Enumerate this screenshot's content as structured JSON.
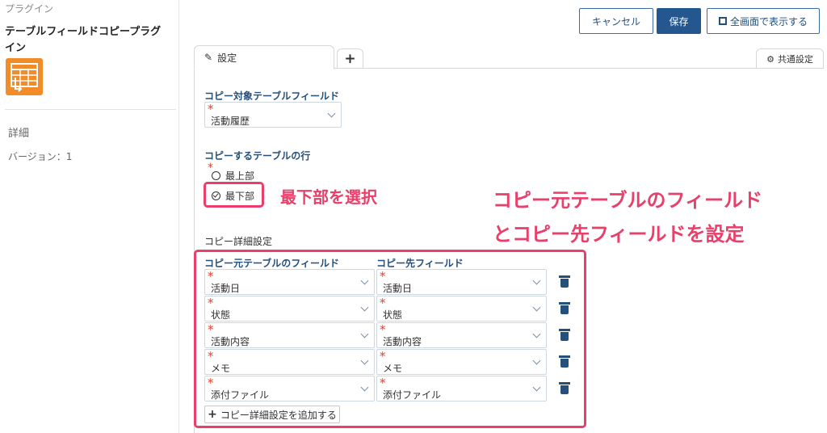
{
  "sidebar": {
    "top_label": "プラグイン",
    "plugin_title": "テーブルフィールドコピープラグイン",
    "detail_label": "詳細",
    "version_label": "バージョン：1",
    "icon_color": "#f28c28"
  },
  "toolbar": {
    "cancel_label": "キャンセル",
    "save_label": "保存",
    "fullscreen_label": "全画面で表示する"
  },
  "tabs": {
    "settings_label": "設定",
    "add_label": "+",
    "common_label": "共通設定"
  },
  "form": {
    "copy_table_label": "コピー対象テーブルフィールド",
    "copy_table_value": "活動履歴",
    "copy_row_label": "コピーするテーブルの行",
    "radio_top": "最上部",
    "radio_bottom": "最下部",
    "detail_section_label": "コピー詳細設定",
    "col_source": "コピー元テーブルのフィールド",
    "col_dest": "コピー先フィールド",
    "rows": [
      {
        "source": "活動日",
        "dest": "活動日"
      },
      {
        "source": "状態",
        "dest": "状態"
      },
      {
        "source": "活動内容",
        "dest": "活動内容"
      },
      {
        "source": "メモ",
        "dest": "メモ"
      },
      {
        "source": "添付ファイル",
        "dest": "添付ファイル"
      }
    ],
    "add_button_label": "コピー詳細設定を追加する"
  },
  "annotations": {
    "select_bottom": "最下部を選択",
    "line1": "コピー元テーブルのフィールド",
    "line2": "とコピー先フィールドを設定",
    "color": "#e8406b"
  }
}
